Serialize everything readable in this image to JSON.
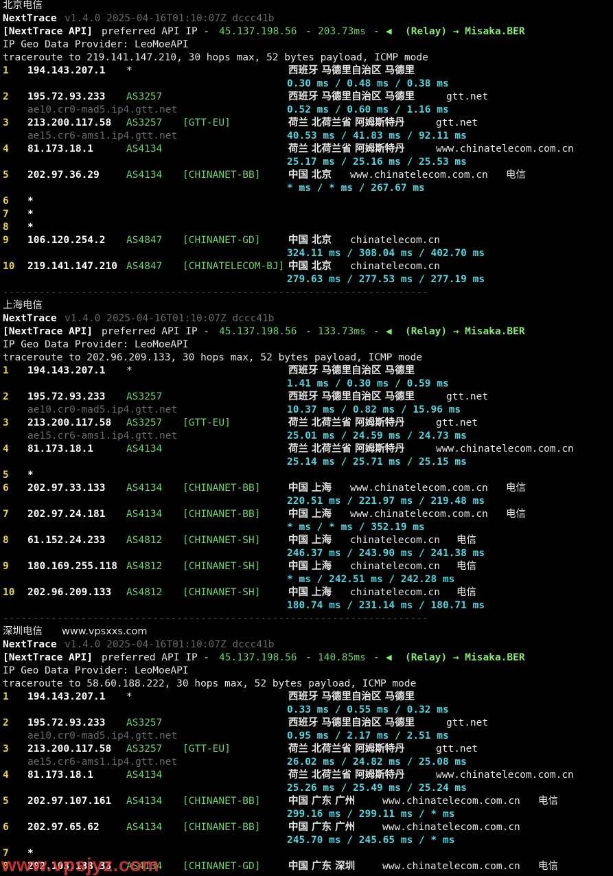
{
  "version_line": {
    "prog": "NextTrace",
    "ver": "v1.4.0 2025-04-16T01:10:07Z dccc41b"
  },
  "api_prefix": "[NextTrace API]",
  "api_mid": "preferred API IP -",
  "api_sep": "-",
  "api_relay": "(Relay) → Misaka.BER",
  "api_icon": "◀",
  "geo_provider": "IP Geo Data Provider: LeoMoeAPI",
  "divider": "-----------------------------------------------------------------------",
  "traces": [
    {
      "title": "北京电信",
      "api_ip": "45.137.198.56",
      "api_ms": "203.73ms",
      "traceroute": "traceroute to 219.141.147.210, 30 hops max, 52 bytes payload, ICMP mode",
      "hops": [
        {
          "n": "1",
          "ip": "194.143.207.1",
          "as": "*",
          "tag": "",
          "geo": "西班牙 马德里自治区 马德里",
          "host": "",
          "isp": "",
          "ptr": "",
          "rtt": "0.30 ms / 0.48 ms / 0.38 ms"
        },
        {
          "n": "2",
          "ip": "195.72.93.233",
          "as": "AS3257",
          "tag": "",
          "geo": "西班牙 马德里自治区 马德里",
          "host": "gtt.net",
          "isp": "",
          "ptr": "ae10.cr0-mad5.ip4.gtt.net",
          "rtt": "0.52 ms / 0.60 ms / 1.16 ms"
        },
        {
          "n": "3",
          "ip": "213.200.117.58",
          "as": "AS3257",
          "tag": "[GTT-EU]",
          "geo": "荷兰 北荷兰省 阿姆斯特丹",
          "host": "gtt.net",
          "isp": "",
          "ptr": "ae15.cr6-ams1.ip4.gtt.net",
          "rtt": "40.53 ms / 41.83 ms / 92.11 ms"
        },
        {
          "n": "4",
          "ip": "81.173.18.1",
          "as": "AS4134",
          "tag": "",
          "geo": "荷兰 北荷兰省 阿姆斯特丹",
          "host": "www.chinatelecom.com.cn",
          "isp": "",
          "ptr": "",
          "rtt": "25.17 ms / 25.16 ms / 25.53 ms"
        },
        {
          "n": "5",
          "ip": "202.97.36.29",
          "as": "AS4134",
          "tag": "[CHINANET-BB]",
          "geo": "中国 北京",
          "host": "www.chinatelecom.com.cn",
          "isp": "电信",
          "ptr": "",
          "rtt": "* ms / * ms / 267.67 ms"
        },
        {
          "n": "6",
          "ip": "*",
          "as": "",
          "tag": "",
          "geo": "",
          "host": "",
          "isp": "",
          "ptr": "",
          "rtt": ""
        },
        {
          "n": "7",
          "ip": "*",
          "as": "",
          "tag": "",
          "geo": "",
          "host": "",
          "isp": "",
          "ptr": "",
          "rtt": ""
        },
        {
          "n": "8",
          "ip": "*",
          "as": "",
          "tag": "",
          "geo": "",
          "host": "",
          "isp": "",
          "ptr": "",
          "rtt": ""
        },
        {
          "n": "9",
          "ip": "106.120.254.2",
          "as": "AS4847",
          "tag": "[CHINANET-GD]",
          "geo": "中国 北京",
          "host": "chinatelecom.cn",
          "isp": "",
          "ptr": "",
          "rtt": "324.11 ms / 308.04 ms / 402.70 ms"
        },
        {
          "n": "10",
          "ip": "219.141.147.210",
          "as": "AS4847",
          "tag": "[CHINATELECOM-BJ]",
          "geo": "中国 北京",
          "host": "chinatelecom.cn",
          "isp": "",
          "ptr": "",
          "rtt": "279.63 ms / 277.53 ms / 277.19 ms"
        }
      ]
    },
    {
      "title": "上海电信",
      "api_ip": "45.137.198.56",
      "api_ms": "133.73ms",
      "traceroute": "traceroute to 202.96.209.133, 30 hops max, 52 bytes payload, ICMP mode",
      "hops": [
        {
          "n": "1",
          "ip": "194.143.207.1",
          "as": "*",
          "tag": "",
          "geo": "西班牙 马德里自治区 马德里",
          "host": "",
          "isp": "",
          "ptr": "",
          "rtt": "1.41 ms / 0.30 ms / 0.59 ms"
        },
        {
          "n": "2",
          "ip": "195.72.93.233",
          "as": "AS3257",
          "tag": "",
          "geo": "西班牙 马德里自治区 马德里",
          "host": "gtt.net",
          "isp": "",
          "ptr": "ae10.cr0-mad5.ip4.gtt.net",
          "rtt": "10.37 ms / 0.82 ms / 15.96 ms"
        },
        {
          "n": "3",
          "ip": "213.200.117.58",
          "as": "AS3257",
          "tag": "[GTT-EU]",
          "geo": "荷兰 北荷兰省 阿姆斯特丹",
          "host": "gtt.net",
          "isp": "",
          "ptr": "ae15.cr6-ams1.ip4.gtt.net",
          "rtt": "25.01 ms / 24.59 ms / 24.73 ms"
        },
        {
          "n": "4",
          "ip": "81.173.18.1",
          "as": "AS4134",
          "tag": "",
          "geo": "荷兰 北荷兰省 阿姆斯特丹",
          "host": "www.chinatelecom.com.cn",
          "isp": "",
          "ptr": "",
          "rtt": "25.14 ms / 25.71 ms / 25.15 ms"
        },
        {
          "n": "5",
          "ip": "*",
          "as": "",
          "tag": "",
          "geo": "",
          "host": "",
          "isp": "",
          "ptr": "",
          "rtt": ""
        },
        {
          "n": "6",
          "ip": "202.97.33.133",
          "as": "AS4134",
          "tag": "[CHINANET-BB]",
          "geo": "中国 上海",
          "host": "www.chinatelecom.com.cn",
          "isp": "电信",
          "ptr": "",
          "rtt": "220.51 ms / 221.97 ms / 219.48 ms"
        },
        {
          "n": "7",
          "ip": "202.97.24.181",
          "as": "AS4134",
          "tag": "[CHINANET-BB]",
          "geo": "中国 上海",
          "host": "www.chinatelecom.com.cn",
          "isp": "电信",
          "ptr": "",
          "rtt": "* ms / * ms / 352.19 ms"
        },
        {
          "n": "8",
          "ip": "61.152.24.233",
          "as": "AS4812",
          "tag": "[CHINANET-SH]",
          "geo": "中国 上海",
          "host": "chinatelecom.cn",
          "isp": "电信",
          "ptr": "",
          "rtt": "246.37 ms / 243.90 ms / 241.38 ms"
        },
        {
          "n": "9",
          "ip": "180.169.255.118",
          "as": "AS4812",
          "tag": "[CHINANET-SH]",
          "geo": "中国 上海",
          "host": "chinatelecom.cn",
          "isp": "电信",
          "ptr": "",
          "rtt": "* ms / 242.51 ms / 242.28 ms"
        },
        {
          "n": "10",
          "ip": "202.96.209.133",
          "as": "AS4812",
          "tag": "[CHINANET-SH]",
          "geo": "中国 上海",
          "host": "chinatelecom.cn",
          "isp": "电信",
          "ptr": "",
          "rtt": "180.74 ms / 231.14 ms / 180.71 ms"
        }
      ]
    },
    {
      "title": "深圳电信",
      "site": "www.vpsxxs.com",
      "api_ip": "45.137.198.56",
      "api_ms": "140.85ms",
      "traceroute": "traceroute to 58.60.188.222, 30 hops max, 52 bytes payload, ICMP mode",
      "hops": [
        {
          "n": "1",
          "ip": "194.143.207.1",
          "as": "*",
          "tag": "",
          "geo": "西班牙 马德里自治区 马德里",
          "host": "",
          "isp": "",
          "ptr": "",
          "rtt": "0.33 ms / 0.55 ms / 0.32 ms"
        },
        {
          "n": "2",
          "ip": "195.72.93.233",
          "as": "AS3257",
          "tag": "",
          "geo": "西班牙 马德里自治区 马德里",
          "host": "gtt.net",
          "isp": "",
          "ptr": "ae10.cr0-mad5.ip4.gtt.net",
          "rtt": "0.95 ms / 2.17 ms / 2.51 ms"
        },
        {
          "n": "3",
          "ip": "213.200.117.58",
          "as": "AS3257",
          "tag": "[GTT-EU]",
          "geo": "荷兰 北荷兰省 阿姆斯特丹",
          "host": "gtt.net",
          "isp": "",
          "ptr": "ae15.cr6-ams1.ip4.gtt.net",
          "rtt": "26.02 ms / 24.82 ms / 25.08 ms"
        },
        {
          "n": "4",
          "ip": "81.173.18.1",
          "as": "AS4134",
          "tag": "",
          "geo": "荷兰 北荷兰省 阿姆斯特丹",
          "host": "www.chinatelecom.com.cn",
          "isp": "",
          "ptr": "",
          "rtt": "25.26 ms / 25.49 ms / 25.24 ms"
        },
        {
          "n": "5",
          "ip": "202.97.107.161",
          "as": "AS4134",
          "tag": "[CHINANET-BB]",
          "geo": "中国 广东 广州",
          "host": "www.chinatelecom.com.cn",
          "isp": "电信",
          "ptr": "",
          "rtt": "299.16 ms / 299.11 ms / * ms"
        },
        {
          "n": "6",
          "ip": "202.97.65.62",
          "as": "AS4134",
          "tag": "[CHINANET-BB]",
          "geo": "中国 广东 广州",
          "host": "www.chinatelecom.com.cn",
          "isp": "",
          "ptr": "",
          "rtt": "245.70 ms / 245.65 ms / * ms"
        },
        {
          "n": "7",
          "ip": "*",
          "as": "",
          "tag": "",
          "geo": "",
          "host": "",
          "isp": "",
          "ptr": "",
          "rtt": ""
        },
        {
          "n": "8",
          "ip": "202.103.138.33",
          "as": "AS4134",
          "tag": "[CHINANET-GD]",
          "geo": "中国 广东 深圳",
          "host": "www.chinatelecom.com.cn",
          "isp": "电信",
          "ptr": "",
          "rtt": ""
        }
      ]
    }
  ],
  "watermark": "www.vpsjyz.com"
}
